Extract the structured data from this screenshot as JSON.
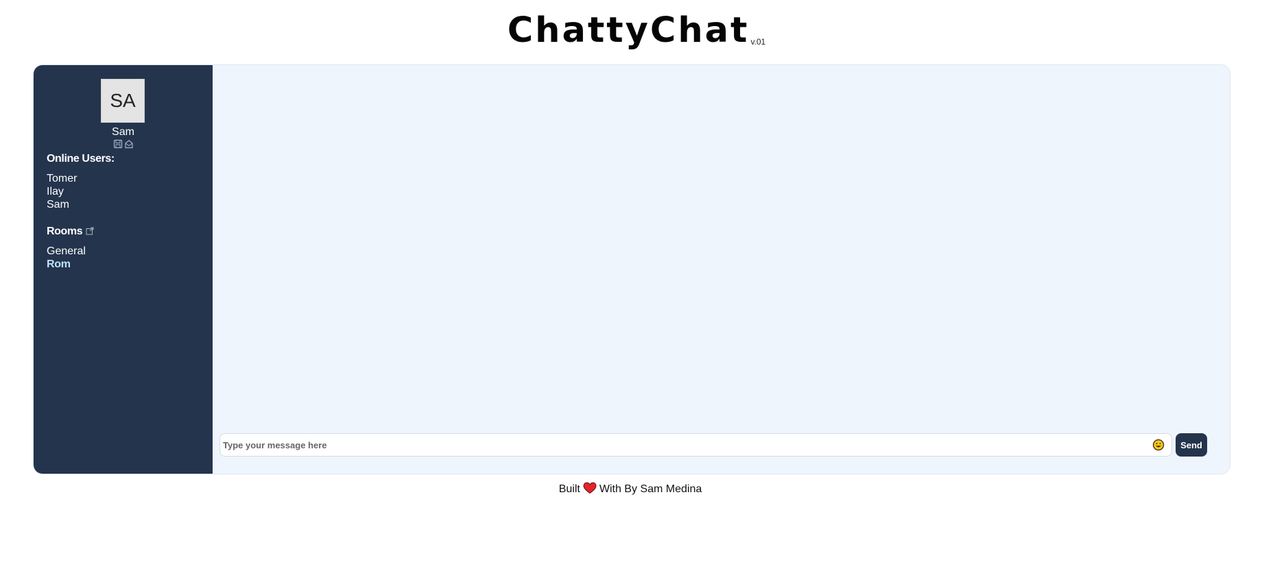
{
  "header": {
    "title": "ChattyChat",
    "version": "v.01"
  },
  "sidebar": {
    "avatar_initials": "SA",
    "user_name": "Sam",
    "action_icons": [
      "save-icon",
      "mail-icon"
    ],
    "online_title": "Online Users:",
    "online_users": [
      "Tomer",
      "Ilay",
      "Sam"
    ],
    "rooms_title": "Rooms",
    "rooms_icon": "external-link-icon",
    "rooms": [
      "General",
      "Rom"
    ],
    "active_room": "Rom"
  },
  "composer": {
    "placeholder": "Type your message here",
    "value": "",
    "emoji_icon": "smiley-emoji-icon",
    "send_label": "Send"
  },
  "footer": {
    "text_before": "Built",
    "icon": "heart-icon",
    "text_after": "With By Sam Medina"
  },
  "colors": {
    "sidebar_bg": "#24344d",
    "chat_bg": "#eff5fd",
    "active_room": "#bfe2ff",
    "heart": "#e3242b"
  }
}
